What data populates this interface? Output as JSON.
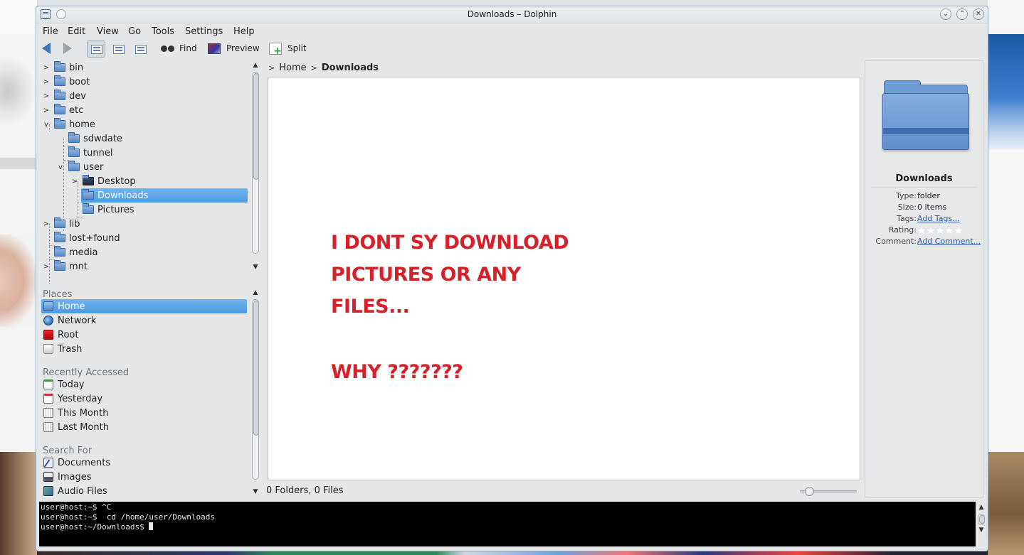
{
  "window": {
    "title": "Downloads – Dolphin"
  },
  "menu": [
    "File",
    "Edit",
    "View",
    "Go",
    "Tools",
    "Settings",
    "Help"
  ],
  "toolbar": {
    "find": "Find",
    "preview": "Preview",
    "split": "Split"
  },
  "tree": [
    {
      "label": "bin",
      "depth": 0,
      "expander": ">"
    },
    {
      "label": "boot",
      "depth": 0,
      "expander": ">"
    },
    {
      "label": "dev",
      "depth": 0,
      "expander": ">"
    },
    {
      "label": "etc",
      "depth": 0,
      "expander": ">"
    },
    {
      "label": "home",
      "depth": 0,
      "expander": "v"
    },
    {
      "label": "sdwdate",
      "depth": 1,
      "expander": ""
    },
    {
      "label": "tunnel",
      "depth": 1,
      "expander": ""
    },
    {
      "label": "user",
      "depth": 1,
      "expander": "v"
    },
    {
      "label": "Desktop",
      "depth": 2,
      "expander": ">"
    },
    {
      "label": "Downloads",
      "depth": 2,
      "expander": "",
      "selected": true
    },
    {
      "label": "Pictures",
      "depth": 2,
      "expander": ""
    },
    {
      "label": "lib",
      "depth": 0,
      "expander": ">"
    },
    {
      "label": "lost+found",
      "depth": 0,
      "expander": ""
    },
    {
      "label": "media",
      "depth": 0,
      "expander": ""
    },
    {
      "label": "mnt",
      "depth": 0,
      "expander": ">"
    }
  ],
  "places": {
    "header": "Places",
    "items": [
      {
        "label": "Home",
        "icon": "home-icon",
        "selected": true
      },
      {
        "label": "Network",
        "icon": "network-icon"
      },
      {
        "label": "Root",
        "icon": "root-icon"
      },
      {
        "label": "Trash",
        "icon": "trash-icon"
      }
    ],
    "recent_header": "Recently Accessed",
    "recent": [
      "Today",
      "Yesterday",
      "This Month",
      "Last Month"
    ],
    "search_header": "Search For",
    "search": [
      "Documents",
      "Images",
      "Audio Files"
    ]
  },
  "breadcrumb": {
    "parent": "Home",
    "current": "Downloads"
  },
  "annotation": {
    "lines": [
      "I DONT SY DOWNLOAD",
      "PICTURES OR ANY",
      "FILES..."
    ],
    "question": "WHY ???????"
  },
  "status": {
    "text": "0 Folders, 0 Files"
  },
  "info": {
    "name": "Downloads",
    "type_label": "Type:",
    "type": "folder",
    "size_label": "Size:",
    "size": "0 items",
    "tags_label": "Tags:",
    "tags": "Add Tags...",
    "rating_label": "Rating:",
    "rating": 0,
    "comment_label": "Comment:",
    "comment": "Add Comment..."
  },
  "terminal": {
    "lines": [
      "user@host:~$ ^C",
      "user@host:~$  cd /home/user/Downloads",
      "user@host:~/Downloads$ "
    ]
  }
}
